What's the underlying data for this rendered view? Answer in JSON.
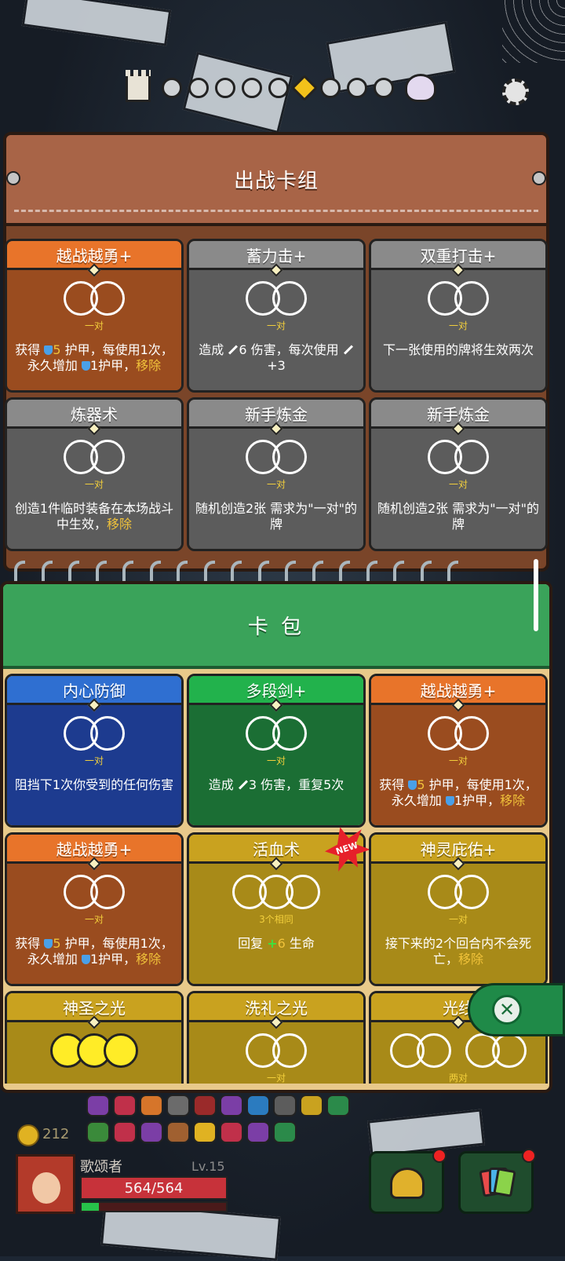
{
  "hud": {
    "gold": "212",
    "player_name": "歌颂者",
    "level": "Lv.15",
    "hp": "564/564",
    "xp_fraction": 0.12
  },
  "deck": {
    "title": "出战卡组",
    "cards": [
      {
        "name": "越战越勇+",
        "color": "orange",
        "req": "一对",
        "rings": 2,
        "desc": [
          {
            "t": "获得 "
          },
          {
            "icon": "shield"
          },
          {
            "t": "5",
            "hl": true
          },
          {
            "t": " 护甲，每使用1次，永久增加 "
          },
          {
            "icon": "shield"
          },
          {
            "t": "1护甲，"
          },
          {
            "t": "移除",
            "hl": true
          }
        ]
      },
      {
        "name": "蓄力击+",
        "color": "gray",
        "req": "一对",
        "rings": 2,
        "desc": [
          {
            "t": "造成 "
          },
          {
            "icon": "sword"
          },
          {
            "t": "6 伤害，每次使用 "
          },
          {
            "icon": "sword"
          },
          {
            "t": "+3"
          }
        ]
      },
      {
        "name": "双重打击+",
        "color": "gray",
        "req": "一对",
        "rings": 2,
        "desc": [
          {
            "t": "下一张使用的牌将生效两次"
          }
        ]
      },
      {
        "name": "炼器术",
        "color": "gray",
        "req": "一对",
        "rings": 2,
        "desc": [
          {
            "t": "创造1件临时装备在本场战斗中生效，"
          },
          {
            "t": "移除",
            "hl": true
          }
        ]
      },
      {
        "name": "新手炼金",
        "color": "gray",
        "req": "一对",
        "rings": 2,
        "desc": [
          {
            "t": "随机创造2张 需求为\"一对\"的牌"
          }
        ]
      },
      {
        "name": "新手炼金",
        "color": "gray",
        "req": "一对",
        "rings": 2,
        "desc": [
          {
            "t": "随机创造2张 需求为\"一对\"的牌"
          }
        ]
      }
    ]
  },
  "pack": {
    "title": "卡 包",
    "cards": [
      {
        "name": "内心防御",
        "color": "blue",
        "req": "一对",
        "rings": 2,
        "desc": [
          {
            "t": "阻挡下1次你受到的任何伤害"
          }
        ]
      },
      {
        "name": "多段剑+",
        "color": "green",
        "req": "一对",
        "rings": 2,
        "desc": [
          {
            "t": "造成 "
          },
          {
            "icon": "sword"
          },
          {
            "t": "3 伤害，重复5次"
          }
        ]
      },
      {
        "name": "越战越勇+",
        "color": "orange",
        "req": "一对",
        "rings": 2,
        "desc": [
          {
            "t": "获得 "
          },
          {
            "icon": "shield"
          },
          {
            "t": "5",
            "hl": true
          },
          {
            "t": " 护甲，每使用1次，永久增加 "
          },
          {
            "icon": "shield"
          },
          {
            "t": "1护甲，"
          },
          {
            "t": "移除",
            "hl": true
          }
        ]
      },
      {
        "name": "越战越勇+",
        "color": "orange",
        "req": "一对",
        "rings": 2,
        "desc": [
          {
            "t": "获得 "
          },
          {
            "icon": "shield"
          },
          {
            "t": "5",
            "hl": true
          },
          {
            "t": " 护甲，每使用1次，永久增加 "
          },
          {
            "icon": "shield"
          },
          {
            "t": "1护甲，"
          },
          {
            "t": "移除",
            "hl": true
          }
        ]
      },
      {
        "name": "活血术",
        "color": "gold",
        "req": "3个相同",
        "rings": 3,
        "new": "NEW",
        "desc": [
          {
            "t": "回复 "
          },
          {
            "icon": "plus"
          },
          {
            "t": "6",
            "hl": true
          },
          {
            "t": " 生命"
          }
        ]
      },
      {
        "name": "神灵庇佑+",
        "color": "gold",
        "req": "一对",
        "rings": 2,
        "desc": [
          {
            "t": "接下来的2个回合内不会死亡，"
          },
          {
            "t": "移除",
            "hl": true
          }
        ]
      },
      {
        "name": "神圣之光",
        "color": "gold",
        "req": "",
        "rings": 3,
        "filled": true,
        "desc": []
      },
      {
        "name": "洗礼之光",
        "color": "gold",
        "req": "一对",
        "rings": 2,
        "desc": []
      },
      {
        "name": "光线",
        "color": "gold",
        "req": "两对",
        "rings": 4,
        "desc": []
      }
    ]
  },
  "icons": {
    "settings": "gear-icon",
    "close": "close-icon",
    "equipment": "helmet-icon",
    "deck": "cards-icon",
    "stage": "tower-icon",
    "boss": "boss-icon"
  },
  "progress": {
    "stages": 9,
    "current": 6
  }
}
